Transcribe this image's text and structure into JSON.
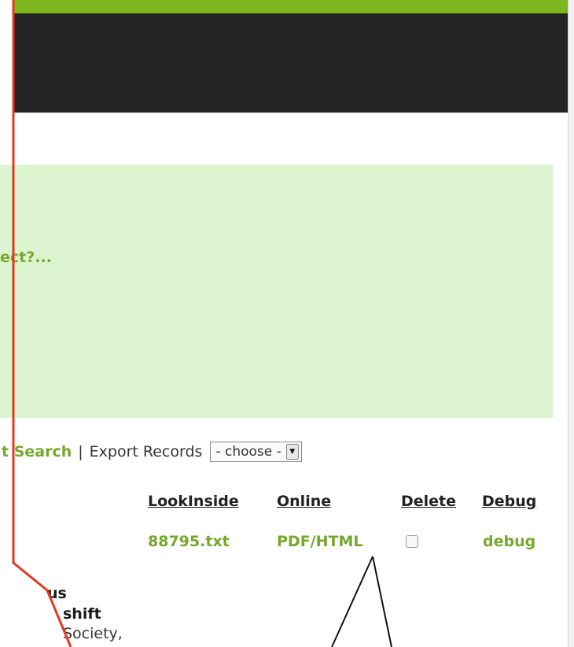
{
  "notice": {
    "text": "ect?..."
  },
  "toolbar": {
    "search_link": "t Search",
    "separator": "|",
    "export_label": "Export Records",
    "export_select_value": "- choose -"
  },
  "table": {
    "headers": [
      "LookInside",
      "Online",
      "Delete",
      "Debug"
    ],
    "row": {
      "lookinside": "88795.txt",
      "online": "PDF/HTML",
      "debug": "debug"
    }
  },
  "record_fragments": [
    "us",
    "shift",
    "Society,"
  ],
  "colors": {
    "accent_green": "#76a82b",
    "header_dark": "#242424",
    "notice_bg": "#dcf4d0",
    "annotation_red": "#e23a1e"
  }
}
